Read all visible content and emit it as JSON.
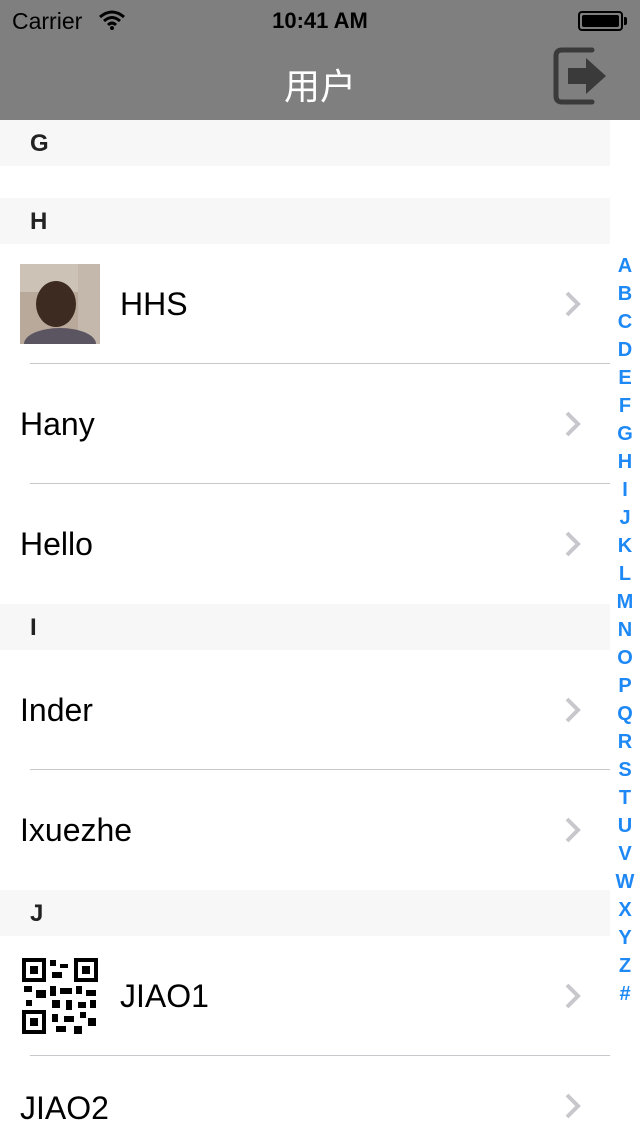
{
  "status_bar": {
    "carrier": "Carrier",
    "time": "10:41 AM",
    "wifi_icon": "wifi-icon",
    "battery_icon": "battery-icon"
  },
  "nav": {
    "title": "用户",
    "logout_icon": "sign-out-icon"
  },
  "sections": [
    {
      "letter": "G",
      "items": []
    },
    {
      "letter": "H",
      "items": [
        {
          "label": "HHS",
          "thumbnail": "photo"
        },
        {
          "label": "Hany",
          "thumbnail": ""
        },
        {
          "label": "Hello",
          "thumbnail": ""
        }
      ]
    },
    {
      "letter": "I",
      "items": [
        {
          "label": "Inder",
          "thumbnail": ""
        },
        {
          "label": "Ixuezhe",
          "thumbnail": ""
        }
      ]
    },
    {
      "letter": "J",
      "items": [
        {
          "label": "JIAO1",
          "thumbnail": "qr-code"
        },
        {
          "label": "JIAO2",
          "thumbnail": ""
        }
      ]
    }
  ],
  "index": [
    "A",
    "B",
    "C",
    "D",
    "E",
    "F",
    "G",
    "H",
    "I",
    "J",
    "K",
    "L",
    "M",
    "N",
    "O",
    "P",
    "Q",
    "R",
    "S",
    "T",
    "U",
    "V",
    "W",
    "X",
    "Y",
    "Z",
    "#"
  ],
  "colors": {
    "nav_background": "#7f7f7f",
    "section_header": "#f7f7f7",
    "index_accent": "#1e88f5",
    "chevron": "#c7c7cc"
  }
}
